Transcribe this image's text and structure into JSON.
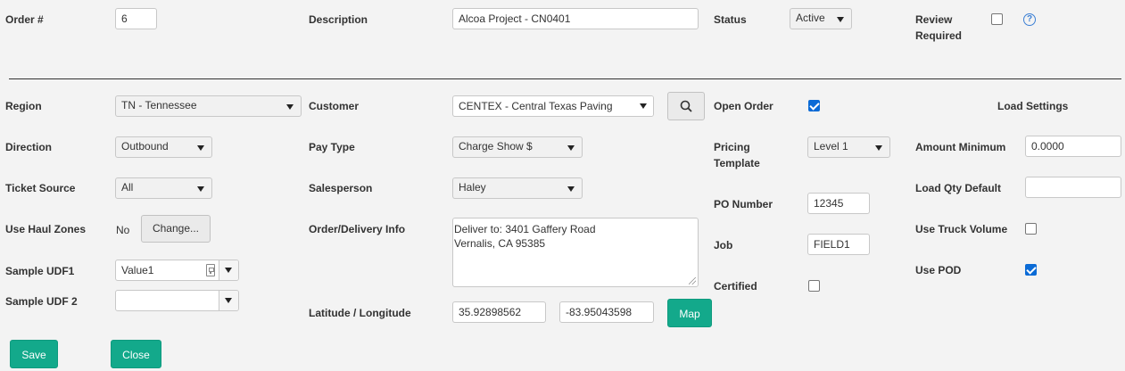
{
  "header": {
    "order_label": "Order #",
    "order_value": "6",
    "description_label": "Description",
    "description_value": "Alcoa Project - CN0401",
    "status_label": "Status",
    "status_value": "Active",
    "review_label_line1": "Review",
    "review_label_line2": "Required",
    "review_checked": false,
    "help_icon": "question-circle-icon"
  },
  "left": {
    "region_label": "Region",
    "region_value": "TN - Tennessee",
    "direction_label": "Direction",
    "direction_value": "Outbound",
    "ticket_source_label": "Ticket Source",
    "ticket_source_value": "All",
    "haul_zones_label": "Use Haul Zones",
    "haul_zones_value": "No",
    "change_button": "Change...",
    "udf1_label": "Sample UDF1",
    "udf1_value": "Value1",
    "udf2_label": "Sample UDF 2",
    "udf2_value": ""
  },
  "middle": {
    "customer_label": "Customer",
    "customer_value": "CENTEX - Central Texas Paving",
    "pay_type_label": "Pay Type",
    "pay_type_value": "Charge Show $",
    "salesperson_label": "Salesperson",
    "salesperson_value": "Haley",
    "delivery_label": "Order/Delivery Info",
    "delivery_line1": "Deliver to: 3401 Gaffery Road",
    "delivery_line2": "Vernalis, CA 95385",
    "latlong_label": "Latitude / Longitude",
    "latitude": "35.92898562",
    "longitude": "-83.95043598",
    "map_button": "Map"
  },
  "right": {
    "open_order_label": "Open Order",
    "open_order_checked": true,
    "pricing_label_line1": "Pricing",
    "pricing_label_line2": "Template",
    "pricing_value": "Level 1",
    "po_label": "PO Number",
    "po_value": "12345",
    "job_label": "Job",
    "job_value": "FIELD1",
    "certified_label": "Certified",
    "certified_checked": false
  },
  "load_settings": {
    "title": "Load Settings",
    "amount_min_label": "Amount Minimum",
    "amount_min_value": "0.0000",
    "load_qty_label": "Load Qty Default",
    "load_qty_value": "",
    "truck_volume_label": "Use Truck Volume",
    "truck_volume_checked": false,
    "pod_label": "Use POD",
    "pod_checked": true
  },
  "footer": {
    "save_button": "Save",
    "close_button": "Close"
  },
  "colors": {
    "accent_green": "#13a98b",
    "checkbox_blue": "#0b6bd6",
    "help_blue": "#3b7fd4"
  }
}
